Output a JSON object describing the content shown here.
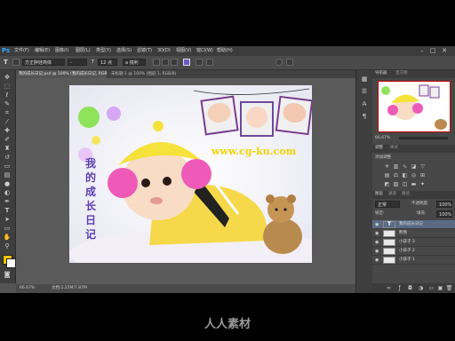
{
  "app": {
    "logo": "Ps",
    "menu": [
      "文件(F)",
      "编辑(E)",
      "图像(I)",
      "图层(L)",
      "类型(Y)",
      "选择(S)",
      "滤镜(T)",
      "3D(D)",
      "视图(V)",
      "窗口(W)",
      "帮助(H)"
    ],
    "window_controls": [
      "–",
      "□",
      "✕"
    ]
  },
  "options_bar": {
    "tool_preset": "T",
    "font_family": "方正胖娃简体",
    "font_style": "-",
    "font_size": "12 点",
    "antialias": "a 锐利",
    "text_color": "#6a5acd"
  },
  "tabs": [
    {
      "label": "我的成长日记.psd @ 100% (我的成长日记, RGB/8) *",
      "active": true
    },
    {
      "label": "未标题-1 @ 100% (图层 1, RGB/8)",
      "active": false
    }
  ],
  "canvas": {
    "title_text": "我的成长日记",
    "watermark_text": "www.cg-ku.com"
  },
  "status": {
    "zoom": "66.67%",
    "doc": "文档:2.25M/7.87M"
  },
  "panels": {
    "navigator_tabs": [
      "导航器",
      "直方图"
    ],
    "nav_zoom": "66.67%",
    "adjust_tabs": [
      "调整",
      "样式"
    ],
    "adjust_title": "添加调整",
    "layers_tabs": [
      "图层",
      "通道",
      "路径"
    ],
    "blend_mode": "正常",
    "opacity_label": "不透明度:",
    "opacity": "100%",
    "fill_label": "填充:",
    "fill": "100%",
    "lock_label": "锁定:",
    "layers": [
      {
        "name": "我的成长日记",
        "selected": true,
        "type": "text"
      },
      {
        "name": "熊熊",
        "selected": false,
        "type": "image"
      },
      {
        "name": "小孩子 3",
        "selected": false,
        "type": "image"
      },
      {
        "name": "小孩子 2",
        "selected": false,
        "type": "image"
      },
      {
        "name": "小孩子 1",
        "selected": false,
        "type": "image"
      }
    ]
  },
  "footer_watermark": "人人素材",
  "colors": {
    "foreground": "#f5c400",
    "background": "#ffffff",
    "accent": "#31a8ff"
  }
}
